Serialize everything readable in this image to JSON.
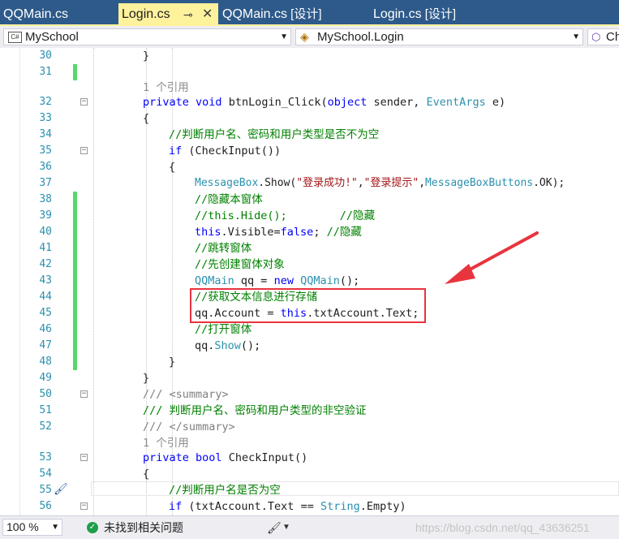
{
  "tabs": [
    {
      "label": "QQMain.cs",
      "suffix": "",
      "active": false
    },
    {
      "label": "Login.cs",
      "suffix": "",
      "active": true
    },
    {
      "label": "QQMain.cs",
      "suffix": " [设计]",
      "active": false
    },
    {
      "label": "Login.cs",
      "suffix": " [设计]",
      "active": false
    }
  ],
  "icons": {
    "pin": "pin-icon",
    "close": "close-icon",
    "brush": "brush-icon",
    "check": "check-circle-icon"
  },
  "navbar": {
    "project": "MySchool",
    "cs_icon_label": "C#",
    "class": "MySchool.Login",
    "member": "Ch"
  },
  "editor": {
    "codelens_text": "1 个引用",
    "lines": [
      {
        "num": "30",
        "indent": 0,
        "text": "}"
      },
      {
        "num": "31",
        "indent": 0,
        "text": ""
      },
      {
        "num": "32",
        "indent": 0,
        "text": "private void btnLogin_Click(object sender, EventArgs e)"
      },
      {
        "num": "33",
        "indent": 0,
        "text": "{"
      },
      {
        "num": "34",
        "indent": 1,
        "text": "//判断用户名、密码和用户类型是否不为空"
      },
      {
        "num": "35",
        "indent": 1,
        "text": "if (CheckInput())"
      },
      {
        "num": "36",
        "indent": 1,
        "text": "{"
      },
      {
        "num": "37",
        "indent": 2,
        "text": "MessageBox.Show(\"登录成功!\",\"登录提示\",MessageBoxButtons.OK);"
      },
      {
        "num": "38",
        "indent": 2,
        "text": "//隐藏本窗体"
      },
      {
        "num": "39",
        "indent": 2,
        "text": "//this.Hide();        //隐藏"
      },
      {
        "num": "40",
        "indent": 2,
        "text": "this.Visible=false; //隐藏"
      },
      {
        "num": "41",
        "indent": 2,
        "text": "//跳转窗体"
      },
      {
        "num": "42",
        "indent": 2,
        "text": "//先创建窗体对象"
      },
      {
        "num": "43",
        "indent": 2,
        "text": "QQMain qq = new QQMain();"
      },
      {
        "num": "44",
        "indent": 2,
        "text": "//获取文本信息进行存储"
      },
      {
        "num": "45",
        "indent": 2,
        "text": "qq.Account = this.txtAccount.Text;"
      },
      {
        "num": "46",
        "indent": 2,
        "text": "//打开窗体"
      },
      {
        "num": "47",
        "indent": 2,
        "text": "qq.Show();"
      },
      {
        "num": "48",
        "indent": 1,
        "text": "}"
      },
      {
        "num": "49",
        "indent": 0,
        "text": "}"
      },
      {
        "num": "50",
        "indent": 0,
        "text": "/// <summary>"
      },
      {
        "num": "51",
        "indent": 0,
        "text": "/// 判断用户名、密码和用户类型的非空验证"
      },
      {
        "num": "52",
        "indent": 0,
        "text": "/// </summary>"
      },
      {
        "num": "53",
        "indent": 0,
        "text": "private bool CheckInput()"
      },
      {
        "num": "54",
        "indent": 0,
        "text": "{"
      },
      {
        "num": "55",
        "indent": 1,
        "text": "//判断用户名是否为空"
      },
      {
        "num": "56",
        "indent": 1,
        "text": "if (txtAccount.Text == String.Empty)"
      }
    ]
  },
  "status": {
    "zoom": "100 %",
    "issues": "未找到相关问题",
    "watermark": "https://blog.csdn.net/qq_43636251"
  }
}
